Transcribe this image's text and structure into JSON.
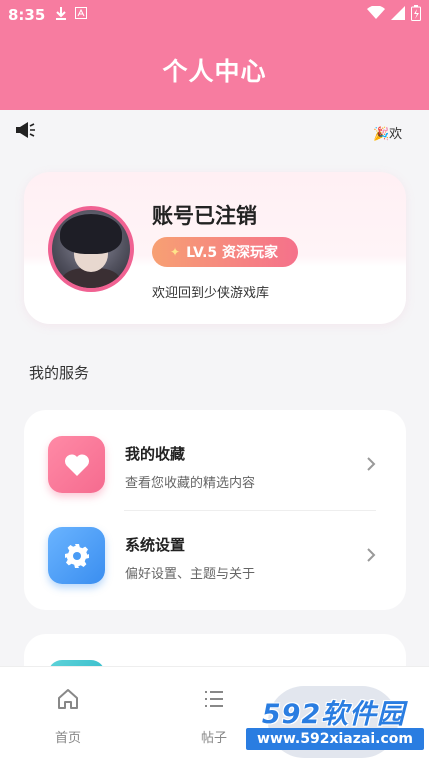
{
  "status_bar": {
    "time": "8:35",
    "icons_left": [
      "download-icon",
      "a-box-icon"
    ],
    "icons_right": [
      "wifi-icon",
      "signal-icon",
      "battery-charging-icon"
    ]
  },
  "header": {
    "title": "个人中心"
  },
  "notice": {
    "marquee_text": "🎉欢"
  },
  "profile": {
    "username": "账号已注销",
    "level": "LV.5 资深玩家",
    "welcome": "欢迎回到少侠游戏库"
  },
  "services": {
    "title": "我的服务",
    "items": [
      {
        "label": "我的收藏",
        "desc": "查看您收藏的精选内容",
        "icon": "heart-icon"
      },
      {
        "label": "系统设置",
        "desc": "偏好设置、主题与关于",
        "icon": "gear-icon"
      }
    ]
  },
  "tabbar": {
    "tabs": [
      {
        "label": "首页",
        "icon": "home-icon"
      },
      {
        "label": "帖子",
        "icon": "list-icon"
      }
    ]
  },
  "watermark": {
    "title": "592软件园",
    "url": "www.592xiazai.com"
  },
  "colors": {
    "brand": "#f77ca0",
    "badge_start": "#f7a073",
    "badge_end": "#f5718b",
    "fav_icon": "#f56b8f",
    "settings_icon": "#3a8ef0"
  }
}
